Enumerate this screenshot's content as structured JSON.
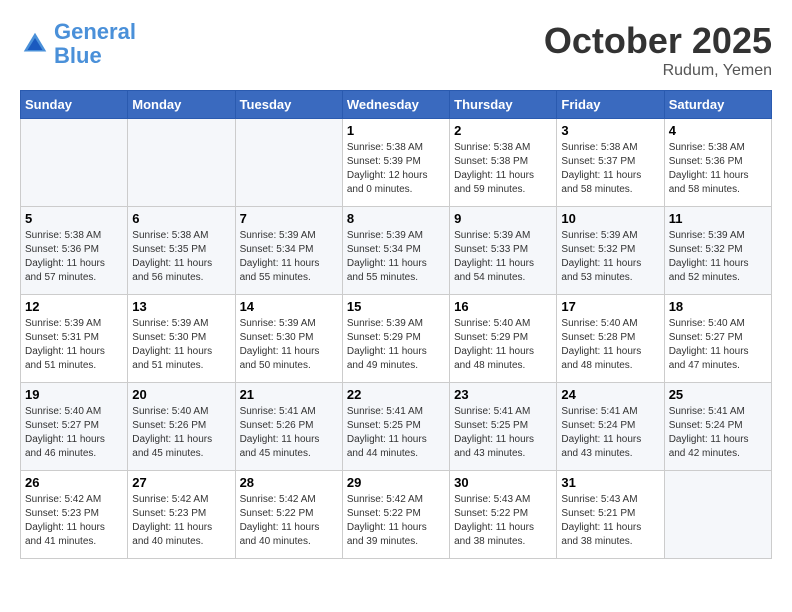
{
  "header": {
    "logo_line1": "General",
    "logo_line2": "Blue",
    "month": "October 2025",
    "location": "Rudum, Yemen"
  },
  "weekdays": [
    "Sunday",
    "Monday",
    "Tuesday",
    "Wednesday",
    "Thursday",
    "Friday",
    "Saturday"
  ],
  "weeks": [
    [
      {
        "day": "",
        "info": ""
      },
      {
        "day": "",
        "info": ""
      },
      {
        "day": "",
        "info": ""
      },
      {
        "day": "1",
        "info": "Sunrise: 5:38 AM\nSunset: 5:39 PM\nDaylight: 12 hours\nand 0 minutes."
      },
      {
        "day": "2",
        "info": "Sunrise: 5:38 AM\nSunset: 5:38 PM\nDaylight: 11 hours\nand 59 minutes."
      },
      {
        "day": "3",
        "info": "Sunrise: 5:38 AM\nSunset: 5:37 PM\nDaylight: 11 hours\nand 58 minutes."
      },
      {
        "day": "4",
        "info": "Sunrise: 5:38 AM\nSunset: 5:36 PM\nDaylight: 11 hours\nand 58 minutes."
      }
    ],
    [
      {
        "day": "5",
        "info": "Sunrise: 5:38 AM\nSunset: 5:36 PM\nDaylight: 11 hours\nand 57 minutes."
      },
      {
        "day": "6",
        "info": "Sunrise: 5:38 AM\nSunset: 5:35 PM\nDaylight: 11 hours\nand 56 minutes."
      },
      {
        "day": "7",
        "info": "Sunrise: 5:39 AM\nSunset: 5:34 PM\nDaylight: 11 hours\nand 55 minutes."
      },
      {
        "day": "8",
        "info": "Sunrise: 5:39 AM\nSunset: 5:34 PM\nDaylight: 11 hours\nand 55 minutes."
      },
      {
        "day": "9",
        "info": "Sunrise: 5:39 AM\nSunset: 5:33 PM\nDaylight: 11 hours\nand 54 minutes."
      },
      {
        "day": "10",
        "info": "Sunrise: 5:39 AM\nSunset: 5:32 PM\nDaylight: 11 hours\nand 53 minutes."
      },
      {
        "day": "11",
        "info": "Sunrise: 5:39 AM\nSunset: 5:32 PM\nDaylight: 11 hours\nand 52 minutes."
      }
    ],
    [
      {
        "day": "12",
        "info": "Sunrise: 5:39 AM\nSunset: 5:31 PM\nDaylight: 11 hours\nand 51 minutes."
      },
      {
        "day": "13",
        "info": "Sunrise: 5:39 AM\nSunset: 5:30 PM\nDaylight: 11 hours\nand 51 minutes."
      },
      {
        "day": "14",
        "info": "Sunrise: 5:39 AM\nSunset: 5:30 PM\nDaylight: 11 hours\nand 50 minutes."
      },
      {
        "day": "15",
        "info": "Sunrise: 5:39 AM\nSunset: 5:29 PM\nDaylight: 11 hours\nand 49 minutes."
      },
      {
        "day": "16",
        "info": "Sunrise: 5:40 AM\nSunset: 5:29 PM\nDaylight: 11 hours\nand 48 minutes."
      },
      {
        "day": "17",
        "info": "Sunrise: 5:40 AM\nSunset: 5:28 PM\nDaylight: 11 hours\nand 48 minutes."
      },
      {
        "day": "18",
        "info": "Sunrise: 5:40 AM\nSunset: 5:27 PM\nDaylight: 11 hours\nand 47 minutes."
      }
    ],
    [
      {
        "day": "19",
        "info": "Sunrise: 5:40 AM\nSunset: 5:27 PM\nDaylight: 11 hours\nand 46 minutes."
      },
      {
        "day": "20",
        "info": "Sunrise: 5:40 AM\nSunset: 5:26 PM\nDaylight: 11 hours\nand 45 minutes."
      },
      {
        "day": "21",
        "info": "Sunrise: 5:41 AM\nSunset: 5:26 PM\nDaylight: 11 hours\nand 45 minutes."
      },
      {
        "day": "22",
        "info": "Sunrise: 5:41 AM\nSunset: 5:25 PM\nDaylight: 11 hours\nand 44 minutes."
      },
      {
        "day": "23",
        "info": "Sunrise: 5:41 AM\nSunset: 5:25 PM\nDaylight: 11 hours\nand 43 minutes."
      },
      {
        "day": "24",
        "info": "Sunrise: 5:41 AM\nSunset: 5:24 PM\nDaylight: 11 hours\nand 43 minutes."
      },
      {
        "day": "25",
        "info": "Sunrise: 5:41 AM\nSunset: 5:24 PM\nDaylight: 11 hours\nand 42 minutes."
      }
    ],
    [
      {
        "day": "26",
        "info": "Sunrise: 5:42 AM\nSunset: 5:23 PM\nDaylight: 11 hours\nand 41 minutes."
      },
      {
        "day": "27",
        "info": "Sunrise: 5:42 AM\nSunset: 5:23 PM\nDaylight: 11 hours\nand 40 minutes."
      },
      {
        "day": "28",
        "info": "Sunrise: 5:42 AM\nSunset: 5:22 PM\nDaylight: 11 hours\nand 40 minutes."
      },
      {
        "day": "29",
        "info": "Sunrise: 5:42 AM\nSunset: 5:22 PM\nDaylight: 11 hours\nand 39 minutes."
      },
      {
        "day": "30",
        "info": "Sunrise: 5:43 AM\nSunset: 5:22 PM\nDaylight: 11 hours\nand 38 minutes."
      },
      {
        "day": "31",
        "info": "Sunrise: 5:43 AM\nSunset: 5:21 PM\nDaylight: 11 hours\nand 38 minutes."
      },
      {
        "day": "",
        "info": ""
      }
    ]
  ]
}
